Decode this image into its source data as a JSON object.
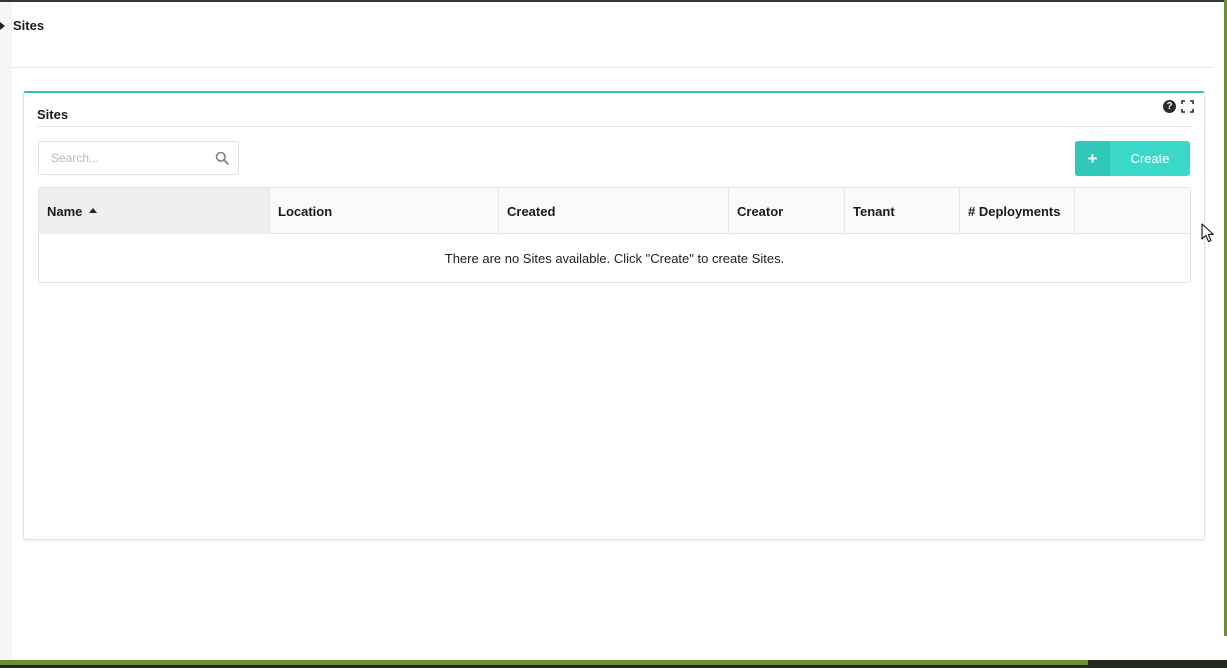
{
  "page": {
    "title": "Sites"
  },
  "widget": {
    "title": "Sites",
    "tools": {
      "help_glyph": "?",
      "help_icon": "question-circle-icon",
      "expand_icon": "expand-icon"
    }
  },
  "search": {
    "value": "",
    "placeholder": "Search...",
    "icon": "search-icon"
  },
  "create_button": {
    "icon_glyph": "+",
    "label": "Create"
  },
  "table": {
    "columns": [
      {
        "label": "Name",
        "sorted": "ascending"
      },
      {
        "label": "Location"
      },
      {
        "label": "Created"
      },
      {
        "label": "Creator"
      },
      {
        "label": "Tenant"
      },
      {
        "label": "# Deployments"
      },
      {
        "label": ""
      }
    ],
    "empty_message": "There are no Sites available. Click \"Create\" to create Sites."
  },
  "colors": {
    "accent": "#32bfc0",
    "create_button": "#3ad8c9",
    "frame_green": "#6b8f2f"
  }
}
